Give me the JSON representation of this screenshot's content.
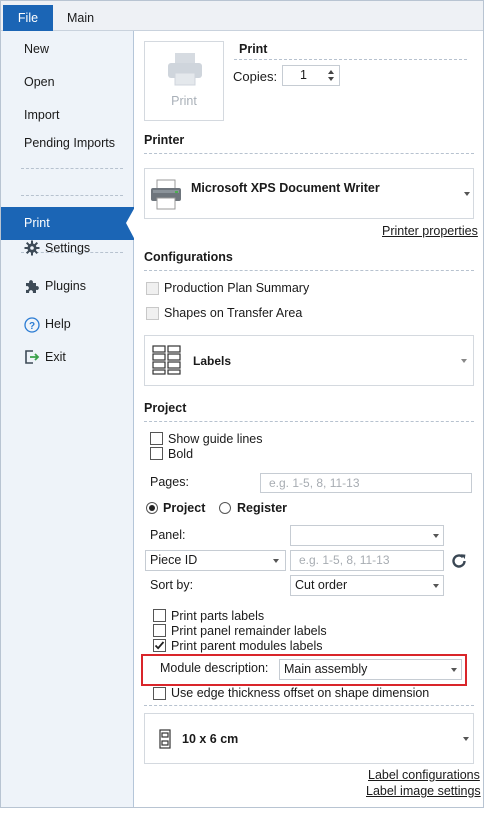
{
  "tabs": {
    "file": "File",
    "main": "Main"
  },
  "sidebar": {
    "new": "New",
    "open": "Open",
    "import": "Import",
    "pending_imports": "Pending Imports",
    "print": "Print",
    "settings": "Settings",
    "plugins": "Plugins",
    "help": "Help",
    "exit": "Exit"
  },
  "print_panel": {
    "print_button_label": "Print",
    "title": "Print",
    "copies_label": "Copies:",
    "copies_value": "1"
  },
  "printer": {
    "section": "Printer",
    "name": "Microsoft XPS Document Writer",
    "properties_link": "Printer properties"
  },
  "configurations": {
    "section": "Configurations",
    "production_plan_summary": "Production Plan Summary",
    "shapes_on_transfer_area": "Shapes on Transfer Area",
    "type_label": "Labels"
  },
  "project": {
    "section": "Project",
    "show_guide_lines": "Show guide lines",
    "bold": "Bold",
    "pages_label": "Pages:",
    "pages_placeholder": "e.g. 1-5, 8, 11-13",
    "radio_project": "Project",
    "radio_register": "Register",
    "panel_label": "Panel:",
    "piece_id_select": "Piece ID",
    "piece_id_placeholder": "e.g. 1-5, 8, 11-13",
    "sort_by_label": "Sort by:",
    "sort_by_value": "Cut order",
    "print_parts_labels": "Print parts labels",
    "print_panel_remainder_labels": "Print panel remainder labels",
    "print_parent_modules_labels": "Print parent modules labels",
    "module_description_label": "Module description:",
    "module_description_value": "Main assembly",
    "use_edge_thickness": "Use edge thickness offset on shape dimension"
  },
  "label_size": {
    "value": "10 x 6 cm",
    "label_configurations_link": "Label configurations",
    "label_image_settings_link": "Label image settings"
  },
  "colors": {
    "accent": "#1b65b5",
    "highlight": "#d9252a"
  }
}
